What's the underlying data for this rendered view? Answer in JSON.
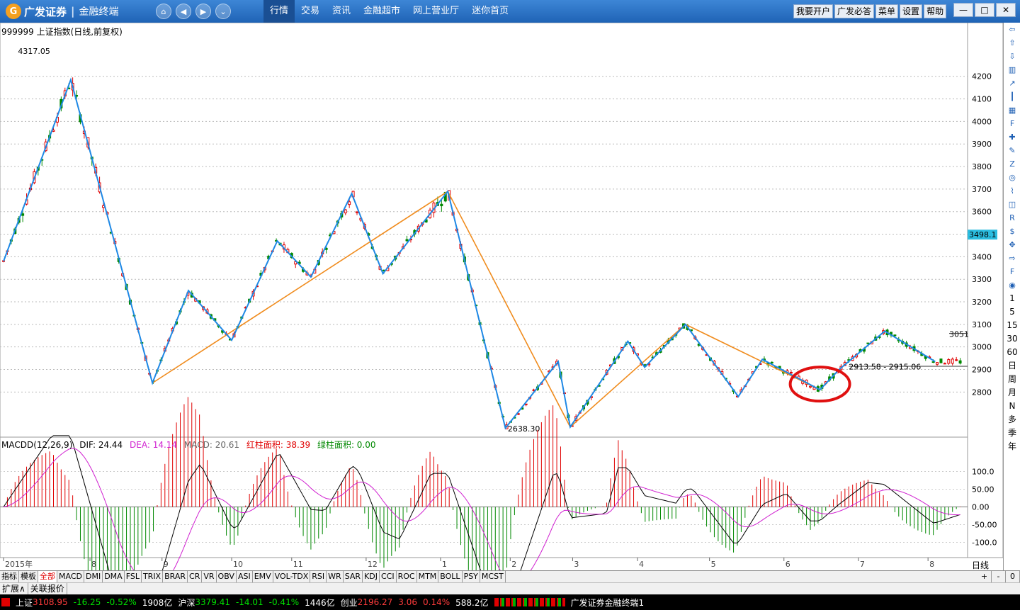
{
  "app": {
    "brand": "广发证券",
    "product": "金融终端",
    "menu": [
      "行情",
      "交易",
      "资讯",
      "金融超市",
      "网上营业厅",
      "迷你首页"
    ],
    "active_menu": "行情",
    "tool_buttons": [
      "我要开户",
      "广发必答",
      "菜单",
      "设置",
      "帮助"
    ],
    "window_buttons": [
      "—",
      "□",
      "✕"
    ]
  },
  "chart_header": {
    "symbol": "999999",
    "name": "上证指数",
    "mode": "(日线,前复权)",
    "full": "999999 上证指数(日线,前复权)"
  },
  "price_axis": {
    "ticks": [
      4200,
      4100,
      4000,
      3900,
      3800,
      3700,
      3600,
      3500,
      3400,
      3300,
      3200,
      3100,
      3000,
      2900,
      2800
    ],
    "current_price_label": "3498.1",
    "last_price_label": "3051"
  },
  "annotations": {
    "high_label": "4317.05",
    "low_label": "2638.30",
    "range_label": "2913.58 - 2915.06"
  },
  "time_axis": {
    "labels": [
      "2015年",
      "8",
      "9",
      "10",
      "11",
      "12",
      "1",
      "2",
      "3",
      "4",
      "5",
      "6",
      "7",
      "8"
    ]
  },
  "macd": {
    "name": "MACDD(12,26,9)",
    "dif_label": "DIF: 24.44",
    "dea_label": "DEA: 14.14",
    "macd_label": "MACD: 20.61",
    "red_area_label": "红柱面积: 38.39",
    "green_area_label": "绿柱面积: 0.00",
    "ticks": [
      "100.0",
      "50.00",
      "0.00",
      "-50.00",
      "-100.0"
    ]
  },
  "right_toolbar": {
    "icons": [
      "arrow-left-icon",
      "arrow-up-icon",
      "arrow-down-icon",
      "candle-icon",
      "line-icon",
      "candle2-icon",
      "bars-icon",
      "fib-icon",
      "cross-icon",
      "brush-icon",
      "fiz-icon",
      "circle-icon",
      "line2-icon",
      "chart-icon",
      "rsi-icon",
      "s-icon",
      "move-icon",
      "arrow-right-icon",
      "fs-icon",
      "eye-icon"
    ],
    "text_buttons_a": [
      "1",
      "5",
      "15",
      "30",
      "60"
    ],
    "text_buttons_b": [
      "日",
      "周",
      "月",
      "N",
      "多",
      "季",
      "年"
    ],
    "rsi_label": "RSI",
    "fs_label": "FS",
    "fio_label": "Fio",
    "fiz_label": "Fiz"
  },
  "period_label": "日线",
  "period_controls": [
    "+",
    "-",
    "0"
  ],
  "indicator_tabs": [
    "指标",
    "模板",
    "全部",
    "MACD",
    "DMI",
    "DMA",
    "FSL",
    "TRIX",
    "BRAR",
    "CR",
    "VR",
    "OBV",
    "ASI",
    "EMV",
    "VOL-TDX",
    "RSI",
    "WR",
    "SAR",
    "KDJ",
    "CCI",
    "ROC",
    "MTM",
    "BOLL",
    "PSY",
    "MCST"
  ],
  "active_indicator_tab": "全部",
  "sub_tabs": [
    "扩展∧",
    "关联报价"
  ],
  "status_bar": {
    "sh_name": "上证",
    "sh_value": "3108.95",
    "sh_change": "-16.25",
    "sh_pct": "-0.52%",
    "sh_amount": "1908亿",
    "hs_name": "沪深",
    "hs_value": "3379.41",
    "hs_change": "-14.01",
    "hs_pct": "-0.41%",
    "hs_amount": "1446亿",
    "cy_name": "创业",
    "cy_value": "2196.27",
    "cy_change": "3.06",
    "cy_pct": "0.14%",
    "cy_amount": "588.2亿",
    "terminal": "广发证券金融终端1"
  },
  "colors": {
    "up": "#e00000",
    "down": "#008800",
    "wave_blue": "#1e88e5",
    "wave_orange": "#f08c1e",
    "dif_line": "#000000",
    "dea_line": "#d020d0",
    "highlight_circle": "#e01010",
    "title_bg": "#2a6fc4"
  },
  "chart_data": {
    "type": "candlestick",
    "ylim": [
      2600,
      4350
    ],
    "zigzag_small": [
      [
        0,
        3380
      ],
      [
        28,
        4185
      ],
      [
        62,
        2840
      ],
      [
        77,
        3250
      ],
      [
        95,
        3030
      ],
      [
        114,
        3470
      ],
      [
        128,
        3310
      ],
      [
        145,
        3680
      ],
      [
        158,
        3325
      ],
      [
        185,
        3690
      ],
      [
        209,
        2640
      ],
      [
        231,
        2935
      ],
      [
        236,
        2645
      ],
      [
        260,
        3025
      ],
      [
        267,
        2910
      ],
      [
        284,
        3100
      ],
      [
        306,
        2780
      ],
      [
        316,
        2945
      ],
      [
        340,
        2810
      ],
      [
        348,
        2900
      ],
      [
        367,
        3070
      ],
      [
        388,
        2935
      ]
    ],
    "zigzag_large": [
      [
        62,
        2840
      ],
      [
        185,
        3690
      ],
      [
        236,
        2645
      ],
      [
        284,
        3100
      ],
      [
        340,
        2810
      ]
    ],
    "highlight": {
      "x": 340,
      "y": 2810
    }
  }
}
